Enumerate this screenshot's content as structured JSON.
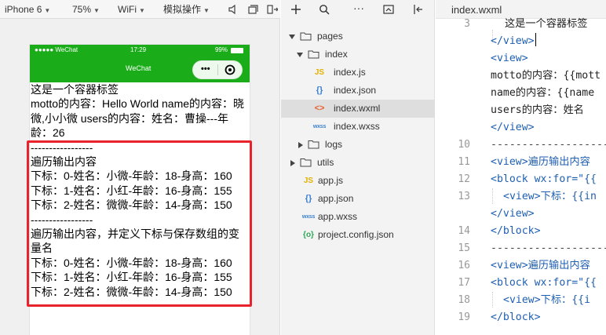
{
  "sim_toolbar": {
    "device": "iPhone 6",
    "zoom": "75%",
    "network": "WiFi",
    "mode": "模拟操作"
  },
  "status_bar": {
    "carrier": "●●●●● WeChat",
    "time": "17:29",
    "battery": "99%"
  },
  "nav_bar": {
    "title": "WeChat",
    "capsule_more": "•••"
  },
  "page_lines": [
    "这是一个容器标签",
    "motto的内容：Hello World name的内容：晓微,小小微 users的内容：姓名：曹操---年龄：26",
    "-----------------",
    "遍历输出内容",
    "下标：0-姓名：小微-年龄：18-身高：160",
    "下标：1-姓名：小红-年龄：16-身高：155",
    "下标：2-姓名：微微-年龄：14-身高：150",
    "-----------------",
    "遍历输出内容，并定义下标与保存数组的变量名",
    "下标：0-姓名：小微-年龄：18-身高：160",
    "下标：1-姓名：小红-年龄：16-身高：155",
    "下标：2-姓名：微微-年龄：14-身高：150"
  ],
  "file_tree": [
    {
      "label": "pages",
      "type": "folder",
      "expanded": true,
      "depth": 0
    },
    {
      "label": "index",
      "type": "folder",
      "expanded": true,
      "depth": 1
    },
    {
      "label": "index.js",
      "type": "js",
      "depth": 2,
      "badge": "JS"
    },
    {
      "label": "index.json",
      "type": "json",
      "depth": 2,
      "badge": "{}"
    },
    {
      "label": "index.wxml",
      "type": "wxml",
      "depth": 2,
      "badge": "<>",
      "selected": true
    },
    {
      "label": "index.wxss",
      "type": "wxss",
      "depth": 2,
      "badge": "wxss"
    },
    {
      "label": "logs",
      "type": "folder",
      "expanded": false,
      "depth": 1
    },
    {
      "label": "utils",
      "type": "folder",
      "expanded": false,
      "depth": 0
    },
    {
      "label": "app.js",
      "type": "js",
      "depth": 0,
      "badge": "JS"
    },
    {
      "label": "app.json",
      "type": "json",
      "depth": 0,
      "badge": "{}"
    },
    {
      "label": "app.wxss",
      "type": "wxss",
      "depth": 0,
      "badge": "wxss"
    },
    {
      "label": "project.config.json",
      "type": "cfg",
      "depth": 0,
      "badge": "{o}"
    }
  ],
  "editor": {
    "tab_title": "index.wxml",
    "lines": [
      {
        "num": "3",
        "text": "这是一个容器标签"
      },
      {
        "num": "",
        "text": "</view>"
      },
      {
        "num": "",
        "text": "<view>"
      },
      {
        "num": "",
        "text": "motto的内容：{{mott"
      },
      {
        "num": "",
        "text": "name的内容：{{name"
      },
      {
        "num": "",
        "text": "users的内容：姓名"
      },
      {
        "num": "",
        "text": "</view>"
      },
      {
        "num": "10",
        "text": "--------------------"
      },
      {
        "num": "11",
        "text": "<view>遍历输出内容"
      },
      {
        "num": "12",
        "text": "<block wx:for=\"{{"
      },
      {
        "num": "13",
        "text": "<view>下标：{{in"
      },
      {
        "num": "",
        "text": "</view>"
      },
      {
        "num": "14",
        "text": "</block>"
      },
      {
        "num": "15",
        "text": "--------------------"
      },
      {
        "num": "16",
        "text": "<view>遍历输出内容"
      },
      {
        "num": "17",
        "text": "<block wx:for=\"{{"
      },
      {
        "num": "18",
        "text": "<view>下标：{{i"
      },
      {
        "num": "19",
        "text": "</block>"
      }
    ]
  },
  "colors": {
    "nav_green": "#1aad19",
    "highlight_red": "#e8232b",
    "tag_blue": "#1f5fb0",
    "attr_green": "#2e7d32"
  }
}
